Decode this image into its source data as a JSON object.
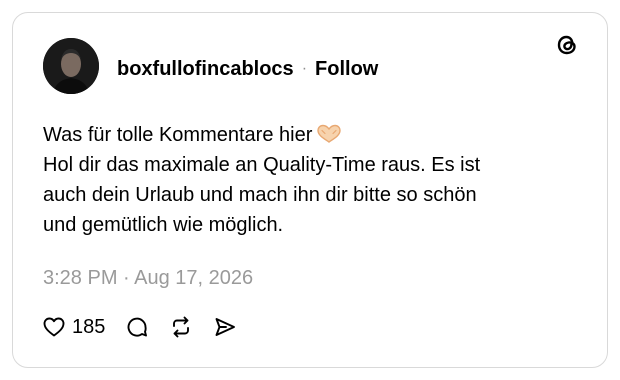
{
  "post": {
    "username": "boxfullofincablocs",
    "separator": "·",
    "follow_label": "Follow",
    "text_lines": [
      "Was für tolle Kommentare hier",
      "Hol dir das maximale an Quality-Time raus. Es ist",
      "auch dein Urlaub und mach ihn dir bitte so schön",
      "und gemütlich wie möglich."
    ],
    "emoji": "heart-hands-emoji",
    "timestamp": "3:28 PM · Aug 17, 2026",
    "like_count": "185"
  },
  "icons": {
    "logo": "threads-logo-icon",
    "like": "heart-icon",
    "comment": "comment-icon",
    "repost": "repost-icon",
    "share": "share-icon"
  },
  "colors": {
    "text": "#000000",
    "muted": "#9a9a9a",
    "border": "#d9d9d9",
    "heart_emoji": "#f5c9a0"
  }
}
